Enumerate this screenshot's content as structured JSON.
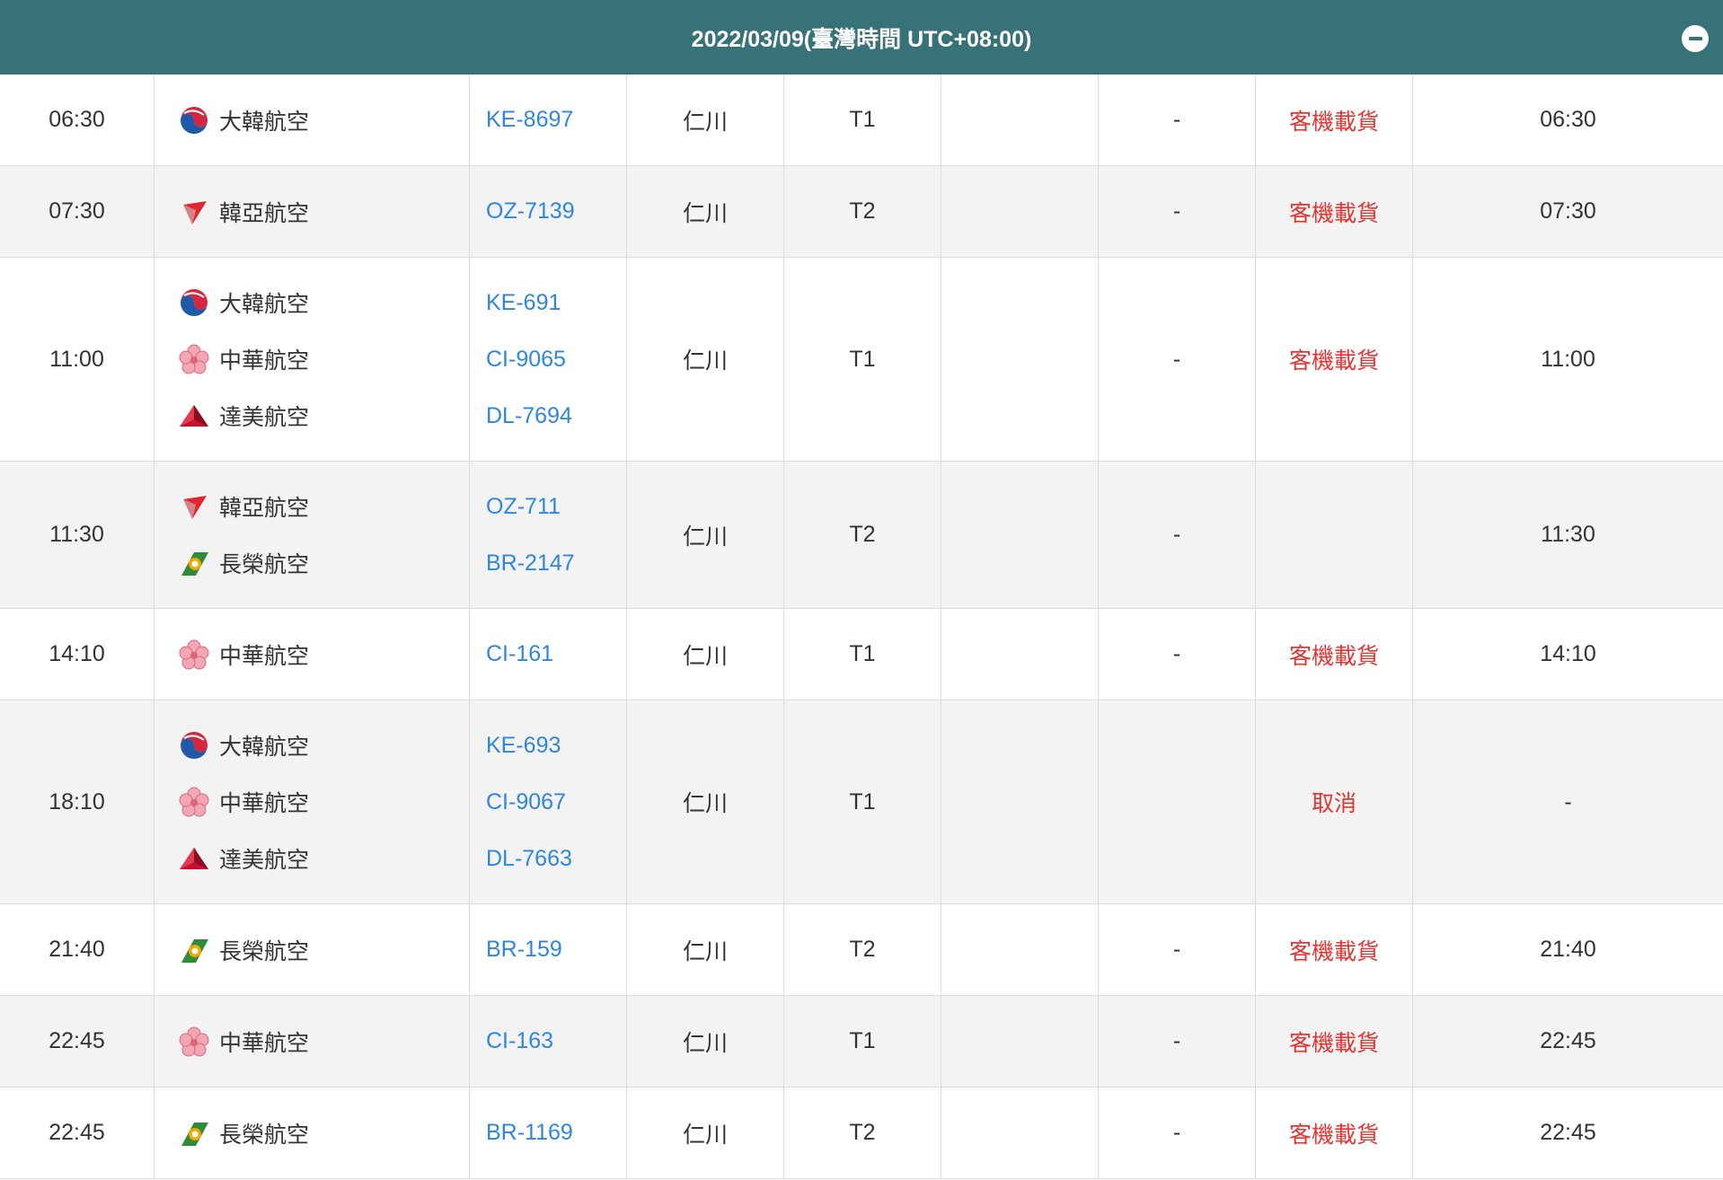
{
  "header": {
    "title": "2022/03/09(臺灣時間 UTC+08:00)"
  },
  "flights": [
    {
      "time": "06:30",
      "airlines": [
        {
          "name": "大韓航空",
          "logo": "korean-air-logo"
        }
      ],
      "codes": [
        "KE-8697"
      ],
      "destination": "仁川",
      "terminal": "T1",
      "col6": "",
      "col7": "-",
      "status": "客機載貨",
      "actual": "06:30"
    },
    {
      "time": "07:30",
      "airlines": [
        {
          "name": "韓亞航空",
          "logo": "asiana-logo"
        }
      ],
      "codes": [
        "OZ-7139"
      ],
      "destination": "仁川",
      "terminal": "T2",
      "col6": "",
      "col7": "-",
      "status": "客機載貨",
      "actual": "07:30"
    },
    {
      "time": "11:00",
      "airlines": [
        {
          "name": "大韓航空",
          "logo": "korean-air-logo"
        },
        {
          "name": "中華航空",
          "logo": "china-airlines-logo"
        },
        {
          "name": "達美航空",
          "logo": "delta-logo"
        }
      ],
      "codes": [
        "KE-691",
        "CI-9065",
        "DL-7694"
      ],
      "destination": "仁川",
      "terminal": "T1",
      "col6": "",
      "col7": "-",
      "status": "客機載貨",
      "actual": "11:00"
    },
    {
      "time": "11:30",
      "airlines": [
        {
          "name": "韓亞航空",
          "logo": "asiana-logo"
        },
        {
          "name": "長榮航空",
          "logo": "eva-air-logo"
        }
      ],
      "codes": [
        "OZ-711",
        "BR-2147"
      ],
      "destination": "仁川",
      "terminal": "T2",
      "col6": "",
      "col7": "-",
      "status": "",
      "actual": "11:30"
    },
    {
      "time": "14:10",
      "airlines": [
        {
          "name": "中華航空",
          "logo": "china-airlines-logo"
        }
      ],
      "codes": [
        "CI-161"
      ],
      "destination": "仁川",
      "terminal": "T1",
      "col6": "",
      "col7": "-",
      "status": "客機載貨",
      "actual": "14:10"
    },
    {
      "time": "18:10",
      "airlines": [
        {
          "name": "大韓航空",
          "logo": "korean-air-logo"
        },
        {
          "name": "中華航空",
          "logo": "china-airlines-logo"
        },
        {
          "name": "達美航空",
          "logo": "delta-logo"
        }
      ],
      "codes": [
        "KE-693",
        "CI-9067",
        "DL-7663"
      ],
      "destination": "仁川",
      "terminal": "T1",
      "col6": "",
      "col7": "",
      "status": "取消",
      "actual": "-"
    },
    {
      "time": "21:40",
      "airlines": [
        {
          "name": "長榮航空",
          "logo": "eva-air-logo"
        }
      ],
      "codes": [
        "BR-159"
      ],
      "destination": "仁川",
      "terminal": "T2",
      "col6": "",
      "col7": "-",
      "status": "客機載貨",
      "actual": "21:40"
    },
    {
      "time": "22:45",
      "airlines": [
        {
          "name": "中華航空",
          "logo": "china-airlines-logo"
        }
      ],
      "codes": [
        "CI-163"
      ],
      "destination": "仁川",
      "terminal": "T1",
      "col6": "",
      "col7": "-",
      "status": "客機載貨",
      "actual": "22:45"
    },
    {
      "time": "22:45",
      "airlines": [
        {
          "name": "長榮航空",
          "logo": "eva-air-logo"
        }
      ],
      "codes": [
        "BR-1169"
      ],
      "destination": "仁川",
      "terminal": "T2",
      "col6": "",
      "col7": "-",
      "status": "客機載貨",
      "actual": "22:45"
    }
  ]
}
